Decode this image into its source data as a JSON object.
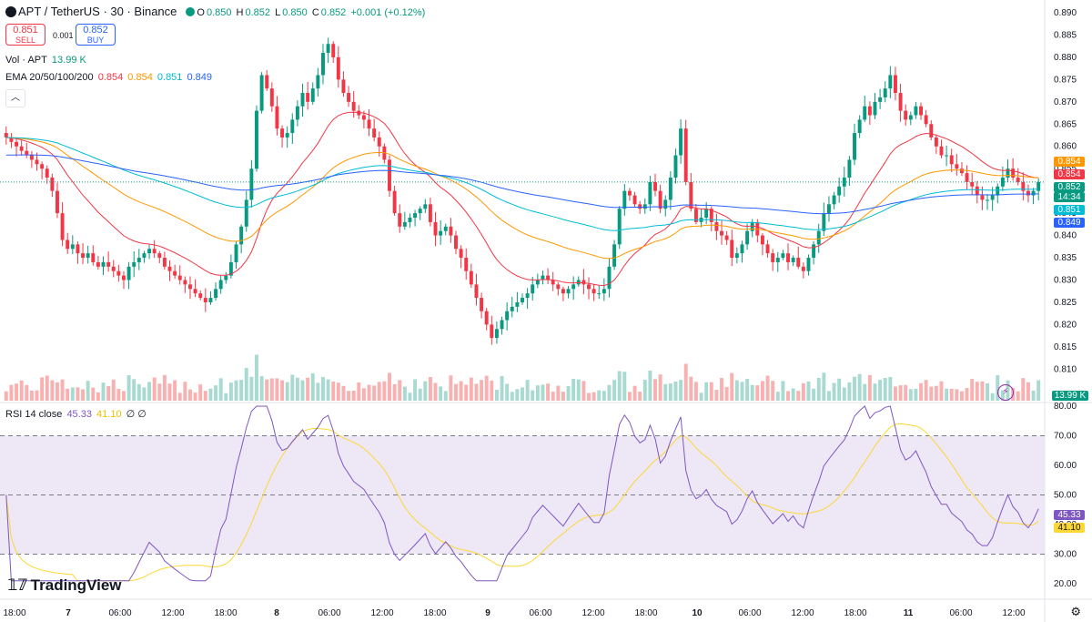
{
  "header": {
    "symbol": "APT",
    "pair_title": "APT / TetherUS · 30 · Binance",
    "ohlc": {
      "o_label": "O",
      "o": "0.850",
      "h_label": "H",
      "h": "0.852",
      "l_label": "L",
      "l": "0.850",
      "c_label": "C",
      "c": "0.852",
      "change": "+0.001 (+0.12%)"
    }
  },
  "trade": {
    "sell_price": "0.851",
    "sell_label": "SELL",
    "spread": "0.001",
    "buy_price": "0.852",
    "buy_label": "BUY"
  },
  "volume_legend": {
    "label": "Vol · APT",
    "value": "13.99 K"
  },
  "ema_legend": {
    "label": "EMA 20/50/100/200",
    "v20": "0.854",
    "v50": "0.854",
    "v100": "0.851",
    "v200": "0.849"
  },
  "rsi_legend": {
    "label": "RSI 14 close",
    "rsi": "45.33",
    "ma": "41.10",
    "tail": "∅ ∅"
  },
  "collapse_icon": "chevron-up-icon",
  "price_tags": {
    "ema50": "0.854",
    "ema20": "0.854",
    "last": "0.852",
    "countdown": "14:34",
    "ema100": "0.851",
    "ema200": "0.849",
    "volume": "13.99 K",
    "rsi": "45.33",
    "rsi_ma": "41.10"
  },
  "logo": {
    "text": "TradingView"
  },
  "colors": {
    "up": "#089981",
    "down": "#f23645",
    "ema20": "#f23645",
    "ema50": "#ff9800",
    "ema100": "#00bcd4",
    "ema200": "#2962ff",
    "rsi": "#7e57c2",
    "rsi_ma": "#fdd835",
    "rsi_band": "#ede7f6"
  },
  "chart_data": [
    {
      "type": "candlestick",
      "title": "APT / TetherUS · 30 · Binance",
      "ylim": [
        0.807,
        0.89
      ],
      "yticks": [
        "0.890",
        "0.885",
        "0.880",
        "0.875",
        "0.870",
        "0.865",
        "0.860",
        "0.855",
        "0.850",
        "0.845",
        "0.840",
        "0.835",
        "0.830",
        "0.825",
        "0.820",
        "0.815",
        "0.810"
      ],
      "xticks": [
        "18:00",
        "7",
        "06:00",
        "12:00",
        "18:00",
        "8",
        "06:00",
        "12:00",
        "18:00",
        "9",
        "06:00",
        "12:00",
        "18:00",
        "10",
        "06:00",
        "12:00",
        "18:00",
        "11",
        "06:00",
        "12:00"
      ],
      "x_range": [
        "2024-11-06 18:00",
        "2024-11-11 12:00"
      ],
      "closes": [
        0.862,
        0.861,
        0.86,
        0.859,
        0.858,
        0.857,
        0.856,
        0.855,
        0.853,
        0.85,
        0.845,
        0.839,
        0.837,
        0.838,
        0.836,
        0.835,
        0.836,
        0.834,
        0.833,
        0.834,
        0.833,
        0.832,
        0.831,
        0.83,
        0.833,
        0.834,
        0.835,
        0.836,
        0.837,
        0.836,
        0.835,
        0.833,
        0.832,
        0.831,
        0.83,
        0.829,
        0.828,
        0.827,
        0.826,
        0.825,
        0.826,
        0.828,
        0.83,
        0.831,
        0.834,
        0.838,
        0.842,
        0.848,
        0.855,
        0.868,
        0.876,
        0.873,
        0.869,
        0.864,
        0.862,
        0.863,
        0.866,
        0.869,
        0.872,
        0.87,
        0.873,
        0.876,
        0.881,
        0.883,
        0.88,
        0.875,
        0.872,
        0.87,
        0.868,
        0.867,
        0.866,
        0.864,
        0.862,
        0.86,
        0.857,
        0.85,
        0.845,
        0.842,
        0.843,
        0.844,
        0.845,
        0.846,
        0.847,
        0.843,
        0.84,
        0.841,
        0.842,
        0.84,
        0.837,
        0.835,
        0.832,
        0.829,
        0.826,
        0.823,
        0.82,
        0.817,
        0.819,
        0.821,
        0.823,
        0.824,
        0.825,
        0.826,
        0.827,
        0.829,
        0.83,
        0.831,
        0.83,
        0.829,
        0.828,
        0.827,
        0.828,
        0.829,
        0.83,
        0.829,
        0.828,
        0.827,
        0.827,
        0.828,
        0.833,
        0.838,
        0.846,
        0.85,
        0.849,
        0.847,
        0.846,
        0.847,
        0.852,
        0.85,
        0.846,
        0.848,
        0.853,
        0.858,
        0.864,
        0.852,
        0.846,
        0.843,
        0.844,
        0.846,
        0.843,
        0.841,
        0.84,
        0.839,
        0.835,
        0.836,
        0.838,
        0.841,
        0.843,
        0.84,
        0.838,
        0.836,
        0.834,
        0.835,
        0.836,
        0.834,
        0.835,
        0.833,
        0.832,
        0.835,
        0.838,
        0.841,
        0.845,
        0.847,
        0.849,
        0.851,
        0.853,
        0.857,
        0.863,
        0.866,
        0.869,
        0.867,
        0.87,
        0.871,
        0.873,
        0.876,
        0.872,
        0.868,
        0.866,
        0.867,
        0.869,
        0.867,
        0.865,
        0.862,
        0.86,
        0.858,
        0.858,
        0.856,
        0.855,
        0.854,
        0.852,
        0.851,
        0.849,
        0.848,
        0.848,
        0.849,
        0.851,
        0.853,
        0.855,
        0.853,
        0.852,
        0.85,
        0.849,
        0.85,
        0.852
      ],
      "volume_last": "13.99 K"
    },
    {
      "type": "line",
      "title": "RSI 14 close",
      "ylim": [
        20,
        80
      ],
      "yticks": [
        "80.00",
        "70.00",
        "60.00",
        "50.00",
        "40.00",
        "30.00",
        "20.00"
      ],
      "band": [
        30,
        70
      ],
      "midline": 50,
      "series": [
        {
          "name": "RSI",
          "last": 45.33
        },
        {
          "name": "MA",
          "last": 41.1
        }
      ]
    }
  ]
}
